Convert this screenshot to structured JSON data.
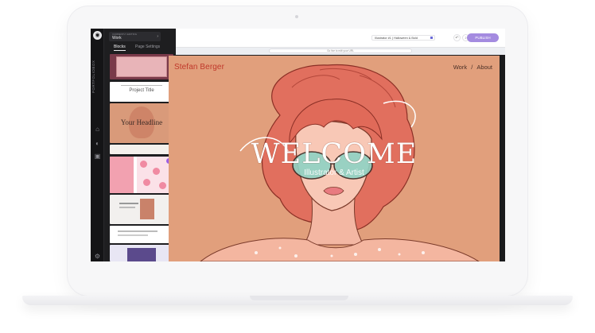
{
  "app": {
    "brand_vertical": "PORTFOLIOBOX",
    "pages_select": {
      "label": "CURRENTLY EDITING",
      "value": "Work"
    },
    "panel_tabs": [
      "Blocks",
      "Page Settings"
    ],
    "thumbnails": [
      {
        "name": "cover-illustration"
      },
      {
        "name": "project-title",
        "text": "Project Title"
      },
      {
        "name": "your-headline",
        "text": "Your Headline"
      },
      {
        "name": "text-strip"
      },
      {
        "name": "pink-pattern-grid"
      },
      {
        "name": "text-with-portrait"
      },
      {
        "name": "text-block"
      },
      {
        "name": "purple-image"
      }
    ],
    "rail_icons": [
      "logo-icon",
      "home-icon",
      "palette-icon",
      "pages-icon",
      "settings-icon"
    ]
  },
  "topbar": {
    "page_select": "Illustrator #1 | Halloween & Bold",
    "publish": "PUBLISH",
    "url_hint": "Go live to edit your URL"
  },
  "site": {
    "brand": "Stefan Berger",
    "nav": [
      "Work",
      "About"
    ],
    "nav_separator": "/",
    "welcome": "WELCOME",
    "subtitle": "Illustrator & Artist"
  },
  "colors": {
    "site_background": "#e19f7c",
    "brand_red": "#c0392b",
    "publish_purple": "#a48be0",
    "editor_dark": "#1e1e20"
  }
}
